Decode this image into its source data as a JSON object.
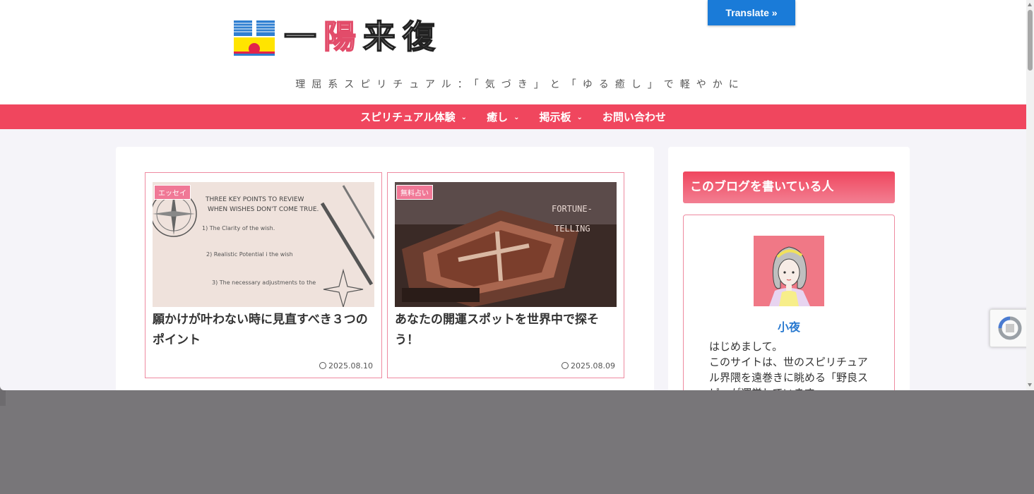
{
  "header": {
    "logo_chars": [
      "一",
      "陽",
      "来",
      "復"
    ],
    "tagline": "理屈系スピリチュアル：「気づき」と「ゆる癒し」で軽やかに",
    "translate_label": "Translate »"
  },
  "nav": {
    "items": [
      {
        "label": "スピリチュアル体験",
        "has_dropdown": true
      },
      {
        "label": "癒し",
        "has_dropdown": true
      },
      {
        "label": "掲示板",
        "has_dropdown": true
      },
      {
        "label": "お問い合わせ",
        "has_dropdown": false
      }
    ]
  },
  "posts": [
    {
      "category": "エッセイ",
      "title": "願かけが叶わない時に見直すべき３つのポイント",
      "date": "2025.08.10",
      "thumb_lines": [
        "THREE KEY POINTS TO REVIEW",
        "WHEN WISHES DON'T COME TRUE.",
        "1) The Clarity of the wish.",
        "2) Realistic Potential i the wish",
        "3) The necessary adjustments to the"
      ]
    },
    {
      "category": "無料占い",
      "title": "あなたの開運スポットを世界中で探そう！",
      "date": "2025.08.09",
      "thumb_lines": [
        "FORTUNE-",
        "TELLING"
      ]
    }
  ],
  "sidebar": {
    "widget_title": "このブログを書いている人",
    "profile_name": "小夜",
    "bio_lines": [
      "はじめまして。",
      "このサイトは、世のスピリチュアル界隈を遠巻きに眺める「野良スピ」が運営しています。"
    ]
  },
  "colors": {
    "accent": "#f0465e",
    "border_pink": "#ee8aa0",
    "link_blue": "#2a7ad0",
    "translate_blue": "#1a7bd8"
  }
}
